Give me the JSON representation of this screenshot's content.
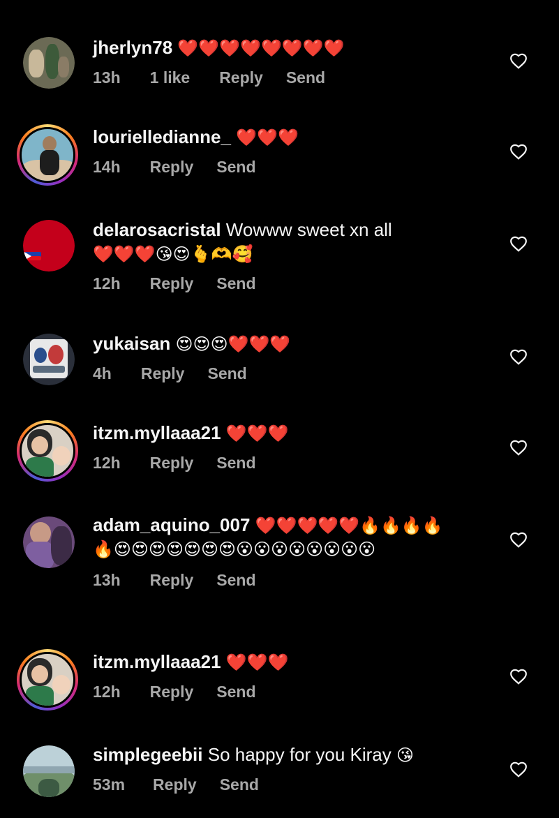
{
  "comments": [
    {
      "username": "jherlyn78",
      "text": "",
      "emoji": "❤️❤️❤️❤️❤️❤️❤️❤️",
      "emoji2": "",
      "time": "13h",
      "likes": "1 like",
      "reply": "Reply",
      "send": "Send",
      "ring": false,
      "avatar_colors": [
        "#6b6a55",
        "#c8b89a",
        "#3d5a3a",
        "#8a7c66"
      ]
    },
    {
      "username": "lourielledianne_",
      "text": "",
      "emoji": "❤️❤️❤️",
      "emoji2": "",
      "time": "14h",
      "likes": "",
      "reply": "Reply",
      "send": "Send",
      "ring": true,
      "avatar_colors": [
        "#7fb5c9",
        "#d9c3a5",
        "#1d1d1d",
        "#a07d5c"
      ]
    },
    {
      "username": "delarosacristal",
      "text": " Wowww sweet xn all",
      "emoji": "",
      "emoji2": "❤️❤️❤️😘😍🫰🫶🥰",
      "time": "12h",
      "likes": "",
      "reply": "Reply",
      "send": "Send",
      "ring": false,
      "avatar_colors": [
        "#c4001b",
        "#c4001b",
        "#1f3fa8",
        "#ffffff"
      ]
    },
    {
      "username": "yukaisan",
      "text": "",
      "emoji": "😍😍😍❤️❤️❤️",
      "emoji2": "",
      "time": "4h",
      "likes": "",
      "reply": "Reply",
      "send": "Send",
      "ring": false,
      "avatar_colors": [
        "#e8e8e8",
        "#2b4f8c",
        "#c23a3a",
        "#5a6b7d"
      ]
    },
    {
      "username": "itzm.myllaaa21",
      "text": "",
      "emoji": "❤️❤️❤️",
      "emoji2": "",
      "time": "12h",
      "likes": "",
      "reply": "Reply",
      "send": "Send",
      "ring": true,
      "avatar_colors": [
        "#d9d0c4",
        "#2a2a2a",
        "#e7c2a5",
        "#2d7a4a"
      ]
    },
    {
      "username": "adam_aquino_007",
      "text": "",
      "emoji": "❤️❤️❤️❤️❤️🔥🔥🔥🔥",
      "emoji2": "🔥😍😍😍😍😍😍😍😮😮😮😮😮😮😮😮",
      "time": "13h",
      "likes": "",
      "reply": "Reply",
      "send": "Send",
      "ring": false,
      "avatar_colors": [
        "#6a4a7a",
        "#c79a86",
        "#3c2b46",
        "#7e5fa0"
      ]
    },
    {
      "username": "itzm.myllaaa21",
      "text": "",
      "emoji": "❤️❤️❤️",
      "emoji2": "",
      "time": "12h",
      "likes": "",
      "reply": "Reply",
      "send": "Send",
      "ring": true,
      "avatar_colors": [
        "#d9d0c4",
        "#2a2a2a",
        "#e7c2a5",
        "#2d7a4a"
      ]
    },
    {
      "username": "simplegeebii",
      "text": " So happy for you Kiray ",
      "emoji": "😘",
      "emoji2": "",
      "time": "53m",
      "likes": "",
      "reply": "Reply",
      "send": "Send",
      "ring": false,
      "avatar_colors": [
        "#bcd1d8",
        "#6f8f6a",
        "#3c5a43",
        "#8fa6b0"
      ]
    }
  ],
  "like_icon": "heart-outline-icon",
  "colors": {
    "background": "#000000",
    "text": "#f5f5f5",
    "meta": "#a8a8a8"
  }
}
